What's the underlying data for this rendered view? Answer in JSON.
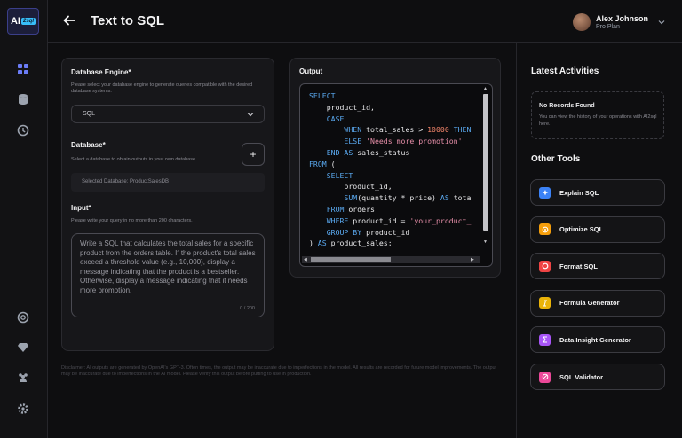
{
  "logo": {
    "text": "AI",
    "badge": "2sql"
  },
  "header": {
    "title": "Text to SQL"
  },
  "user": {
    "name": "Alex Johnson",
    "plan": "Pro Plan"
  },
  "engine": {
    "label": "Database Engine*",
    "help": "Please select your database engine to generate queries compatible with the desired database systems.",
    "selected": "SQL"
  },
  "database": {
    "label": "Database*",
    "help": "Select a database to obtain outputs in your own database.",
    "add_label": "+",
    "selected": "Selected Database: ProductSalesDB"
  },
  "input": {
    "label": "Input*",
    "help": "Please write your query in no more than 200 characters.",
    "value": "Write a SQL that calculates the total sales for a specific product from the orders table. If the product's total sales exceed a threshold value (e.g., 10,000), display a message indicating that the product is a bestseller. Otherwise, display a message indicating that it needs more promotion.",
    "counter": "0 / 200"
  },
  "output": {
    "title": "Output",
    "code": [
      [
        {
          "t": "SELECT",
          "c": "kw"
        }
      ],
      [
        {
          "t": "    product_id,",
          "c": ""
        }
      ],
      [
        {
          "t": "    CASE",
          "c": "kw"
        }
      ],
      [
        {
          "t": "        WHEN ",
          "c": "kw"
        },
        {
          "t": "total_sales > ",
          "c": ""
        },
        {
          "t": "10000",
          "c": "num"
        },
        {
          "t": " THEN",
          "c": "kw"
        }
      ],
      [
        {
          "t": "        ELSE ",
          "c": "kw"
        },
        {
          "t": "'Needs more promotion'",
          "c": "str"
        }
      ],
      [
        {
          "t": "    END AS ",
          "c": "kw"
        },
        {
          "t": "sales_status",
          "c": ""
        }
      ],
      [
        {
          "t": "FROM",
          "c": "kw"
        },
        {
          "t": " (",
          "c": ""
        }
      ],
      [
        {
          "t": "    SELECT",
          "c": "kw"
        }
      ],
      [
        {
          "t": "        product_id,",
          "c": ""
        }
      ],
      [
        {
          "t": "        SUM",
          "c": "kw"
        },
        {
          "t": "(quantity * price) ",
          "c": ""
        },
        {
          "t": "AS",
          "c": "kw"
        },
        {
          "t": " tota",
          "c": ""
        }
      ],
      [
        {
          "t": "    FROM",
          "c": "kw"
        },
        {
          "t": " orders",
          "c": ""
        }
      ],
      [
        {
          "t": "    WHERE",
          "c": "kw"
        },
        {
          "t": " product_id = ",
          "c": ""
        },
        {
          "t": "'your_product_",
          "c": "str"
        }
      ],
      [
        {
          "t": "    GROUP BY",
          "c": "kw"
        },
        {
          "t": " product_id",
          "c": ""
        }
      ],
      [
        {
          "t": ") ",
          "c": ""
        },
        {
          "t": "AS",
          "c": "kw"
        },
        {
          "t": " product_sales;",
          "c": ""
        }
      ]
    ]
  },
  "disclaimer": "Disclaimer: AI outputs are generated by OpenAI's GPT-3. Often times, the output may be inaccurate due to imperfections in the model. All results are recorded for future model improvements. The output may be inaccurate due to imperfections in the AI model. Please verify this output before putting to use in production.",
  "latest": {
    "title": "Latest Activities",
    "empty_title": "No Records Found",
    "empty_desc": "You can view the history of your operations with AI2sql here."
  },
  "tools": {
    "title": "Other Tools",
    "items": [
      {
        "name": "Explain SQL",
        "color": "#3b82f6"
      },
      {
        "name": "Optimize SQL",
        "color": "#f59e0b"
      },
      {
        "name": "Format SQL",
        "color": "#ef4444"
      },
      {
        "name": "Formula Generator",
        "color": "#eab308"
      },
      {
        "name": "Data Insight Generator",
        "color": "#a855f7"
      },
      {
        "name": "SQL Validator",
        "color": "#ec4899"
      }
    ]
  }
}
